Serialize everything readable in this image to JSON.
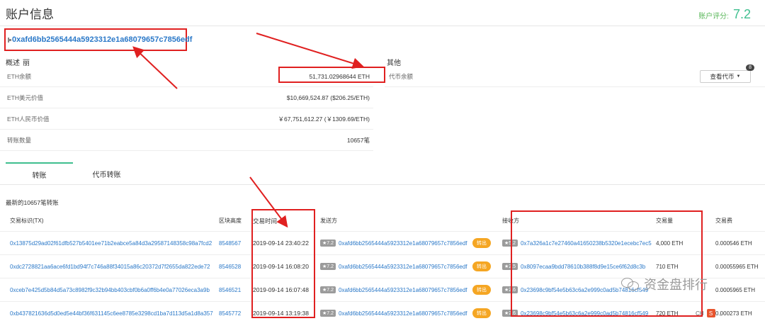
{
  "header": {
    "title": "账户信息",
    "score_label": "账户评分:",
    "score_value": "7.2"
  },
  "account": {
    "address": "0xafd6bb2565444a5923312e1a68079657c7856edf"
  },
  "overview": {
    "title": "概述",
    "title_icon": "丽",
    "rows": [
      {
        "label": "ETH余额",
        "value": "51,731.02968644 ETH"
      },
      {
        "label": "ETH美元价值",
        "value": "$10,669,524.87 ($206.25/ETH)"
      },
      {
        "label": "ETH人民币价值",
        "value": "￥67,751,612.27 (￥1309.69/ETH)"
      },
      {
        "label": "转账数量",
        "value": "10657笔"
      }
    ]
  },
  "other": {
    "title": "其他",
    "token_balance_label": "代币余额",
    "view_token_button": "查看代币",
    "token_count": "8"
  },
  "tabs": [
    {
      "label": "转账"
    },
    {
      "label": "代币转账"
    }
  ],
  "transactions": {
    "count_text": "最新的10657笔转账",
    "headers": {
      "tx": "交易标识(TX)",
      "block": "区块高度",
      "time": "交易时间",
      "from": "发送方",
      "to": "接收方",
      "amount": "交易量",
      "fee": "交易费"
    },
    "rows": [
      {
        "tx": "0x13875d29ad02f61dfb527b5401ee71b2eabce5a84d3a29587148358c98a7fcd2",
        "block": "8548567",
        "time": "2019-09-14 23:40:22",
        "from_score": "7.2",
        "from": "0xafd6bb2565444a5923312e1a68079657c7856edf",
        "direction": "转出",
        "to_score": "5.2",
        "to": "0x7a326a1c7e27460a41650238b5320e1ecebc7ec5",
        "amount": "4,000 ETH",
        "fee": "0.000546 ETH"
      },
      {
        "tx": "0xdc2728821aa6ace6fd1bd94f7c746a88f34015a86c20372d7f2655da822ede72",
        "block": "8546528",
        "time": "2019-09-14 16:08:20",
        "from_score": "7.2",
        "from": "0xafd6bb2565444a5923312e1a68079657c7856edf",
        "direction": "转出",
        "to_score": "2.5",
        "to": "0x8097ecaa9bdd78610b388f8d9e15ce6f62d8c3b",
        "amount": "710 ETH",
        "fee": "0.00055965 ETH"
      },
      {
        "tx": "0xceb7e425d5b84d5a73c8982f9c32b94bb403cbf0b6a0ff6b4e0a77026eca3a9b",
        "block": "8546521",
        "time": "2019-09-14 16:07:48",
        "from_score": "7.2",
        "from": "0xafd6bb2565444a5923312e1a68079657c7856edf",
        "direction": "转出",
        "to_score": "2.6",
        "to": "0x23698c9bf54e5b63c6a2e999c0ad5b74816cf549",
        "amount": "",
        "fee": "0.0005965 ETH"
      },
      {
        "tx": "0xb437821636d5d0ed5e44bf36f631145c6ee8785e3298cd1ba7d113d5a1d8a357",
        "block": "8545772",
        "time": "2019-09-14 13:19:38",
        "from_score": "7.2",
        "from": "0xafd6bb2565444a5923312e1a68079657c7856edf",
        "direction": "转出",
        "to_score": "2.6",
        "to": "0x23698c9bf54e5b63c6a2e999c0ad5b74816cf549",
        "amount": "720 ETH",
        "fee": "0.000273 ETH"
      }
    ]
  },
  "watermark": {
    "text": "资金盘排行"
  },
  "floating_toolbar": {
    "lang": "CH"
  },
  "colors": {
    "accent": "#3fbf8f",
    "link": "#2a78c8",
    "highlight": "#e02020",
    "out_badge": "#f5a623"
  }
}
